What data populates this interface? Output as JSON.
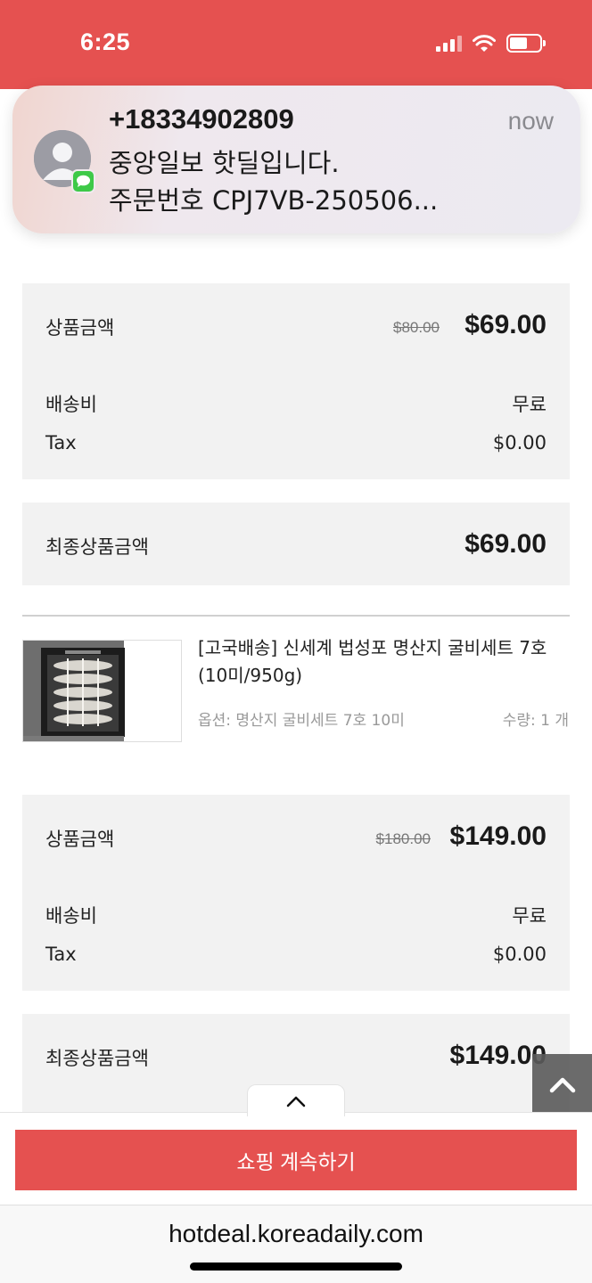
{
  "status_bar": {
    "time": "6:25"
  },
  "notification": {
    "sender": "+18334902809",
    "time": "now",
    "line1": "중앙일보 핫딜입니다.",
    "line2": "주문번호 CPJ7VB-250506..."
  },
  "order1": {
    "product_amount_label": "상품금액",
    "original_price": "$80.00",
    "price": "$69.00",
    "shipping_label": "배송비",
    "shipping_value": "무료",
    "tax_label": "Tax",
    "tax_value": "$0.00",
    "final_label": "최종상품금액",
    "final_value": "$69.00"
  },
  "product2": {
    "title": "[고국배송] 신세계 법성포 명산지 굴비세트 7호(10미/950g)",
    "option": "옵션: 명산지 굴비세트 7호 10미",
    "quantity": "수량: 1 개"
  },
  "order2": {
    "product_amount_label": "상품금액",
    "original_price": "$180.00",
    "price": "$149.00",
    "shipping_label": "배송비",
    "shipping_value": "무료",
    "tax_label": "Tax",
    "tax_value": "$0.00",
    "final_label": "최종상품금액",
    "final_value": "$149.00"
  },
  "cta": {
    "label": "쇼핑 계속하기"
  },
  "browser": {
    "url": "hotdeal.koreadaily.com"
  },
  "colors": {
    "accent": "#e55150",
    "box_bg": "#f2f2f2"
  }
}
